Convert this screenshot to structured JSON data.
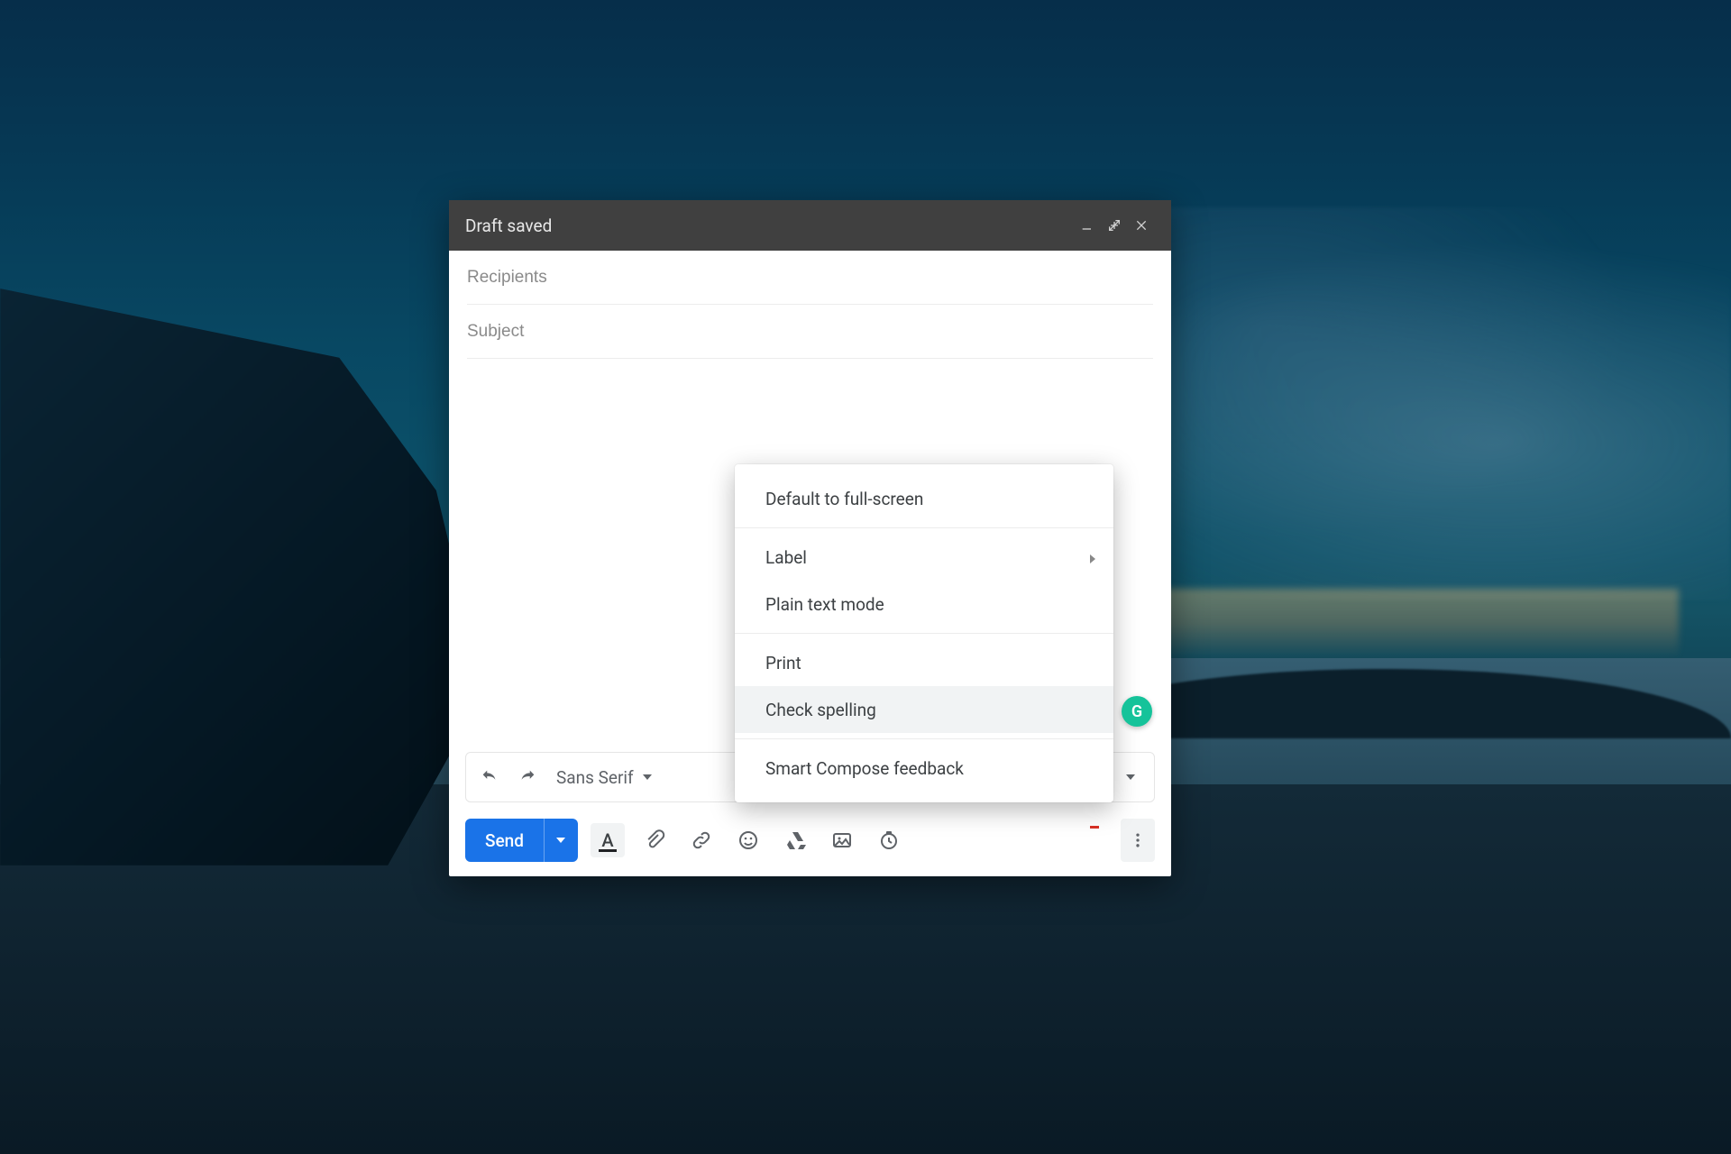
{
  "titlebar": {
    "title": "Draft saved"
  },
  "fields": {
    "recipients_placeholder": "Recipients",
    "subject_placeholder": "Subject"
  },
  "format_bar": {
    "font": "Sans Serif"
  },
  "send": {
    "label": "Send"
  },
  "grammarly": {
    "glyph": "G"
  },
  "menu": {
    "default_fullscreen": "Default to full-screen",
    "label": "Label",
    "plain_text": "Plain text mode",
    "print": "Print",
    "check_spelling": "Check spelling",
    "smart_compose_feedback": "Smart Compose feedback"
  }
}
